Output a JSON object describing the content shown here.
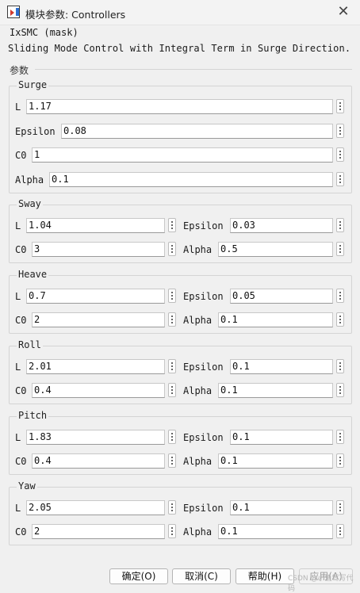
{
  "window": {
    "title": "模块参数: Controllers",
    "close_glyph": "✕"
  },
  "mask": {
    "title": "IxSMC (mask)",
    "description": "Sliding Mode Control with Integral Term in Surge Direction."
  },
  "params_label": "参数",
  "surge": {
    "title": "Surge",
    "L": {
      "label": "L",
      "value": "1.17"
    },
    "Epsilon": {
      "label": "Epsilon",
      "value": "0.08"
    },
    "C0": {
      "label": "C0",
      "value": "1"
    },
    "Alpha": {
      "label": "Alpha",
      "value": "0.1"
    }
  },
  "sway": {
    "title": "Sway",
    "L": {
      "label": "L",
      "value": "1.04"
    },
    "Epsilon": {
      "label": "Epsilon",
      "value": "0.03"
    },
    "C0": {
      "label": "C0",
      "value": "3"
    },
    "Alpha": {
      "label": "Alpha",
      "value": "0.5"
    }
  },
  "heave": {
    "title": "Heave",
    "L": {
      "label": "L",
      "value": "0.7"
    },
    "Epsilon": {
      "label": "Epsilon",
      "value": "0.05"
    },
    "C0": {
      "label": "C0",
      "value": "2"
    },
    "Alpha": {
      "label": "Alpha",
      "value": "0.1"
    }
  },
  "roll": {
    "title": "Roll",
    "L": {
      "label": "L",
      "value": "2.01"
    },
    "Epsilon": {
      "label": "Epsilon",
      "value": "0.1"
    },
    "C0": {
      "label": "C0",
      "value": "0.4"
    },
    "Alpha": {
      "label": "Alpha",
      "value": "0.1"
    }
  },
  "pitch": {
    "title": "Pitch",
    "L": {
      "label": "L",
      "value": "1.83"
    },
    "Epsilon": {
      "label": "Epsilon",
      "value": "0.1"
    },
    "C0": {
      "label": "C0",
      "value": "0.4"
    },
    "Alpha": {
      "label": "Alpha",
      "value": "0.1"
    }
  },
  "yaw": {
    "title": "Yaw",
    "L": {
      "label": "L",
      "value": "2.05"
    },
    "Epsilon": {
      "label": "Epsilon",
      "value": "0.1"
    },
    "C0": {
      "label": "C0",
      "value": "2"
    },
    "Alpha": {
      "label": "Alpha",
      "value": "0.1"
    }
  },
  "buttons": {
    "ok": "确定(O)",
    "cancel": "取消(C)",
    "help": "帮助(H)",
    "apply": "应用(A)"
  },
  "watermark": "CSDN @小鱼驾写代码"
}
